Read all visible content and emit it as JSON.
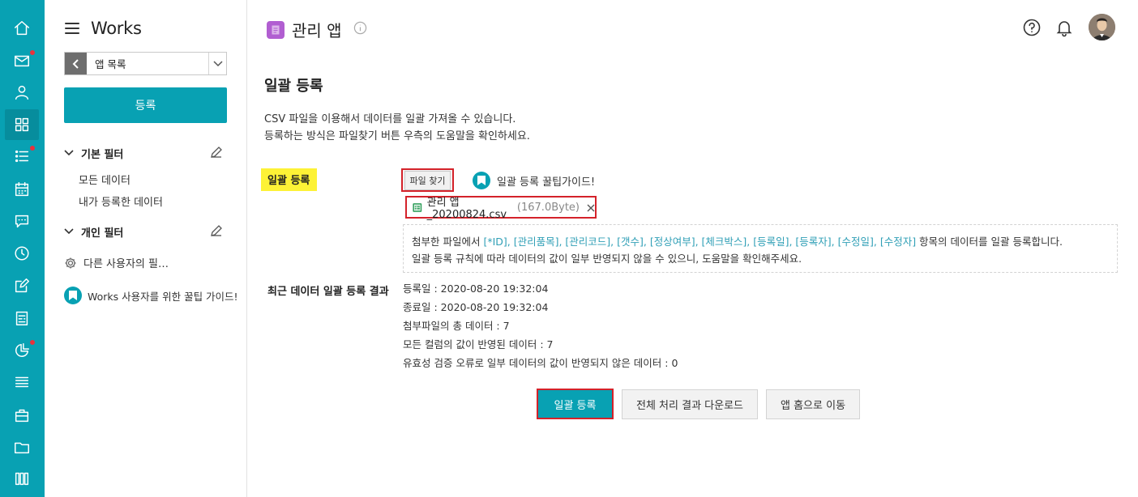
{
  "rail": {
    "items": [
      {
        "icon": "home-icon",
        "active": false,
        "badge": false
      },
      {
        "icon": "mail-icon",
        "active": false,
        "badge": true
      },
      {
        "icon": "person-icon",
        "active": false,
        "badge": false
      },
      {
        "icon": "apps-grid-icon",
        "active": true,
        "badge": false
      },
      {
        "icon": "list-icon",
        "active": false,
        "badge": true
      },
      {
        "icon": "calendar-icon",
        "active": false,
        "badge": false
      },
      {
        "icon": "chat-icon",
        "active": false,
        "badge": false
      },
      {
        "icon": "clock-icon",
        "active": false,
        "badge": false
      },
      {
        "icon": "edit-note-icon",
        "active": false,
        "badge": false
      },
      {
        "icon": "form-icon",
        "active": false,
        "badge": false
      },
      {
        "icon": "pie-chart-icon",
        "active": false,
        "badge": true
      },
      {
        "icon": "stack-icon",
        "active": false,
        "badge": false
      },
      {
        "icon": "briefcase-icon",
        "active": false,
        "badge": false
      },
      {
        "icon": "folder-icon",
        "active": false,
        "badge": false
      },
      {
        "icon": "building-icon",
        "active": false,
        "badge": false
      }
    ]
  },
  "sidebar": {
    "brand": "Works",
    "app_select": "앱 목록",
    "register_label": "등록",
    "basic_filter": {
      "title": "기본 필터",
      "items": [
        "모든 데이터",
        "내가 등록한 데이터"
      ]
    },
    "personal_filter": {
      "title": "개인 필터"
    },
    "other_users_filter": "다른 사용자의 필…",
    "tip": "Works 사용자를 위한 꿀팁 가이드!"
  },
  "header": {
    "app_title": "관리 앱"
  },
  "main": {
    "heading": "일괄 등록",
    "desc_line1": "CSV 파일을 이용해서 데이터를 일괄 가져올 수 있습니다.",
    "desc_line2": "등록하는 방식은 파일찾기 버튼 우측의 도움말을 확인하세요.",
    "bulk_label": "일괄 등록",
    "find_file": "파일 찾기",
    "guide": "일괄 등록 꿀팁가이드!",
    "file_name": "관리 앱_20200824.csv",
    "file_size": "(167.0Byte)",
    "notice_prefix": "첨부한 파일에서 ",
    "notice_fields": "[*ID], [관리품목], [관리코드], [갯수], [정상여부], [체크박스], [등록일], [등록자], [수정일], [수정자]",
    "notice_suffix": " 항목의 데이터를 일괄 등록합니다.",
    "notice_line2": "일괄 등록 규칙에 따라 데이터의 값이 일부 반영되지 않을 수 있으니, 도움말을 확인해주세요.",
    "result_label": "최근 데이터 일괄 등록 결과",
    "results": [
      "등록일 : 2020-08-20 19:32:04",
      "종료일 : 2020-08-20 19:32:04",
      "첨부파일의 총 데이터 : 7",
      "모든 컬럼의 값이 반영된 데이터 : 7",
      "유효성 검증 오류로 일부 데이터의 값이 반영되지 않은 데이터 : 0"
    ],
    "btn_bulk": "일괄 등록",
    "btn_download": "전체 처리 결과 다운로드",
    "btn_home": "앱 홈으로 이동"
  },
  "colors": {
    "accent": "#08a1b3",
    "highlight": "#fdf236",
    "alert": "#d4222a",
    "app_icon": "#b15ed1"
  }
}
